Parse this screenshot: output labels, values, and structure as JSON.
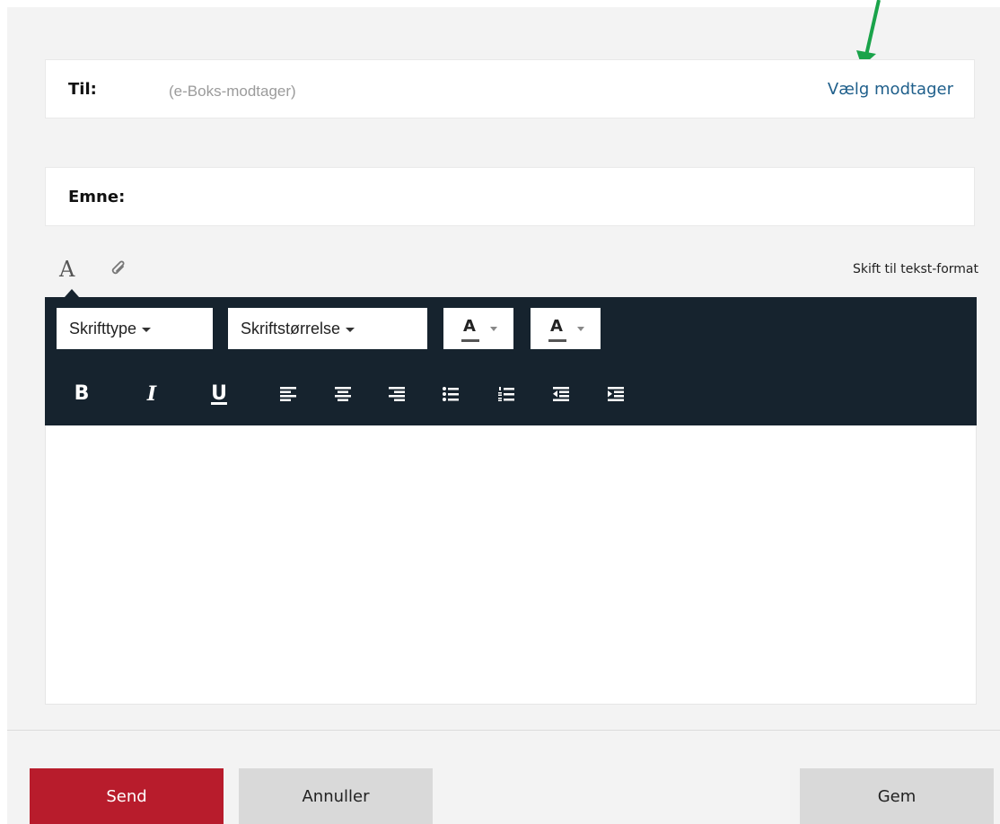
{
  "compose": {
    "to_label": "Til:",
    "to_placeholder": "(e-Boks-modtager)",
    "choose_recipient": "Vælg modtager",
    "subject_label": "Emne:"
  },
  "editor": {
    "font_tab_glyph": "A",
    "switch_format": "Skift til tekst-format",
    "font_dropdown": "Skrifttype",
    "size_dropdown": "Skriftstørrelse",
    "text_color_letter": "A",
    "bg_color_letter": "A",
    "bold": "B",
    "italic": "I",
    "underline": "U",
    "icons": [
      "align-left-icon",
      "align-center-icon",
      "align-right-icon",
      "bullet-list-icon",
      "numbered-list-icon",
      "outdent-icon",
      "indent-icon"
    ]
  },
  "actions": {
    "send": "Send",
    "cancel": "Annuller",
    "save": "Gem"
  },
  "colors": {
    "toolbar_bg": "#16232e",
    "send_bg": "#b81c2c",
    "link": "#1f5f8b",
    "annotation_arrow": "#1aa34a"
  }
}
